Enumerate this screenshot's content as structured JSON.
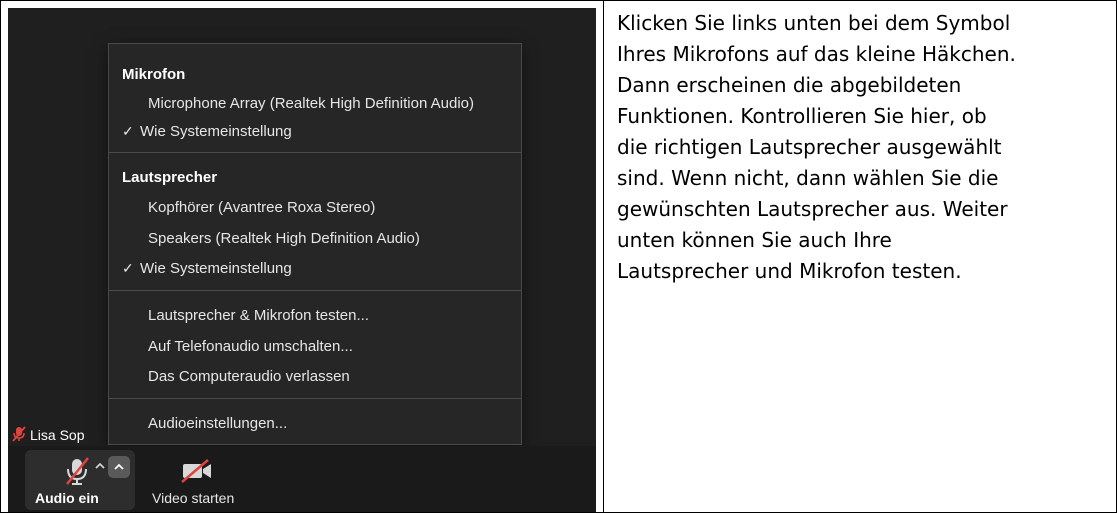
{
  "menu": {
    "microphone": {
      "title": "Mikrofon",
      "items": [
        "Microphone Array (Realtek High Definition Audio)",
        "Wie Systemeinstellung"
      ],
      "selected_index": 1
    },
    "speaker": {
      "title": "Lautsprecher",
      "items": [
        "Kopfhörer (Avantree Roxa Stereo)",
        "Speakers (Realtek High Definition Audio)",
        "Wie Systemeinstellung"
      ],
      "selected_index": 2
    },
    "actions": [
      "Lautsprecher & Mikrofon testen...",
      "Auf Telefonaudio umschalten...",
      "Das Computeraudio verlassen"
    ],
    "settings": "Audioeinstellungen...",
    "check_mark": "✓"
  },
  "participant": {
    "name": "Lisa Sop"
  },
  "toolbar": {
    "audio_label": "Audio ein",
    "video_label": "Video starten"
  },
  "instruction_lines": [
    "Klicken Sie links unten bei dem Symbol",
    "Ihres Mikrofons auf das kleine Häkchen.",
    "Dann erscheinen die abgebildeten",
    "Funktionen. Kontrollieren Sie hier, ob",
    "die richtigen Lautsprecher ausgewählt",
    "sind. Wenn nicht, dann wählen Sie die",
    "gewünschten Lautsprecher aus. Weiter",
    "unten können Sie auch Ihre",
    "Lautsprecher und Mikrofon testen."
  ],
  "colors": {
    "muted": "#e0443e",
    "menu_bg": "#262626",
    "toolbar_bg": "#1a1a1a"
  }
}
